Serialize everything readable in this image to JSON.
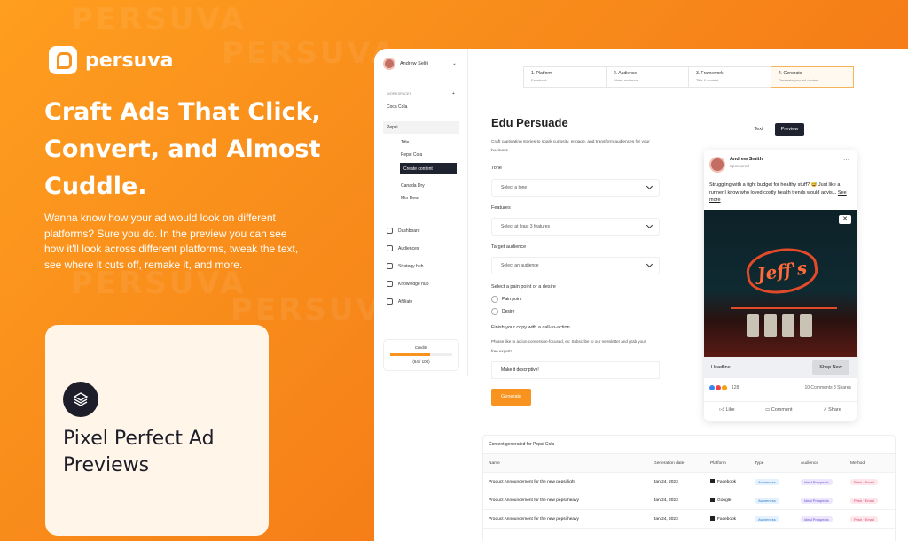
{
  "brand": {
    "name": "persuva",
    "watermark": "PERSUVA",
    "accent": "#f7931e",
    "dark": "#1e1e2a"
  },
  "hero": {
    "headline": "Craft Ads That Click, Convert, and Almost Cuddle.",
    "subtext": "Wanna know how your ad would look on different platforms? Sure you do. In the preview you can see how it'll look across different platforms, tweak the text, see where it cuts off, remake it, and more."
  },
  "feature_card": {
    "title": "Pixel Perfect Ad Previews",
    "icon": "layers-icon"
  },
  "app": {
    "user": "Andrew Seliti",
    "workspaces_label": "WORKSPACES",
    "workspaces": [
      "Coca Cola",
      "Pepsi"
    ],
    "sub_items": [
      "Title",
      "Pepsi Cola",
      "Create content",
      "Canada Dry",
      "Mtn Dew"
    ],
    "nav": [
      {
        "label": "Dashboard",
        "icon": "grid-icon"
      },
      {
        "label": "Audiences",
        "icon": "calendar-icon"
      },
      {
        "label": "Strategy hub",
        "icon": "check-icon"
      },
      {
        "label": "Knowledge hub",
        "icon": "book-icon"
      },
      {
        "label": "Affiliate",
        "icon": "users-icon"
      }
    ],
    "credits": {
      "label": "Credits",
      "value": "(64 / 100)",
      "fraction": 0.64
    },
    "steps": [
      {
        "title": "1. Platform",
        "sub": "Facebook"
      },
      {
        "title": "2. Audience",
        "sub": "Warm audience"
      },
      {
        "title": "3. Framework",
        "sub": "Title & content"
      },
      {
        "title": "4. Generate",
        "sub": "Generate your ad content"
      }
    ],
    "form": {
      "title": "Edu Persuade",
      "description": "Craft captivating stories to spark curiosity, engage, and transform audiences for your business.",
      "tone_label": "Tone",
      "tone_placeholder": "Select a tone",
      "features_label": "Features",
      "features_placeholder": "Select at least 3 features",
      "audience_label": "Target audience",
      "audience_placeholder": "Select an audience",
      "pain_label": "Select a pain point or a desire",
      "options": [
        "Pain point",
        "Desire"
      ],
      "cta_label": "Finish your copy with a call-to-action",
      "cta_desc": "Phrase like to action conversion-focused, ex: Subscribe to our newsletter and grab your free expert!",
      "cta_value": "Make it descriptive!",
      "generate": "Generate"
    },
    "preview": {
      "toggle": [
        "Text",
        "Preview"
      ],
      "author": "Andrew Smith",
      "sponsored": "Sponsored",
      "text": "Struggling with a tight budget for healthy stuff? 😅 Just like a runner I know who loved costly health trends would advis...",
      "see_more": "See more",
      "sign": "Jeff's",
      "headline": "Headline",
      "shop": "Shop Now",
      "reactions": "128",
      "comments": "10 Comments  8 Shares",
      "actions": [
        "Like",
        "Comment",
        "Share"
      ]
    },
    "table": {
      "title": "Content generated for Pepsi Cola",
      "headers": [
        "Name",
        "Generation date",
        "Platform",
        "Type",
        "Audience",
        "Method"
      ],
      "rows": [
        {
          "name": "Product Announcement for the new pepsi light",
          "date": "Jan 24, 2023",
          "platform": "Facebook",
          "type": "Awareness",
          "audience": "Ideal Prospects",
          "method": "Push · Email"
        },
        {
          "name": "Product Announcement for the new pepsi heavy",
          "date": "Jan 24, 2023",
          "platform": "Google",
          "type": "Awareness",
          "audience": "Ideal Prospects",
          "method": "Push · Email"
        },
        {
          "name": "Product Announcement for the new pepsi heavy",
          "date": "Jan 24, 2023",
          "platform": "Facebook",
          "type": "Awareness",
          "audience": "Ideal Prospects",
          "method": "Push · Email"
        }
      ]
    }
  }
}
